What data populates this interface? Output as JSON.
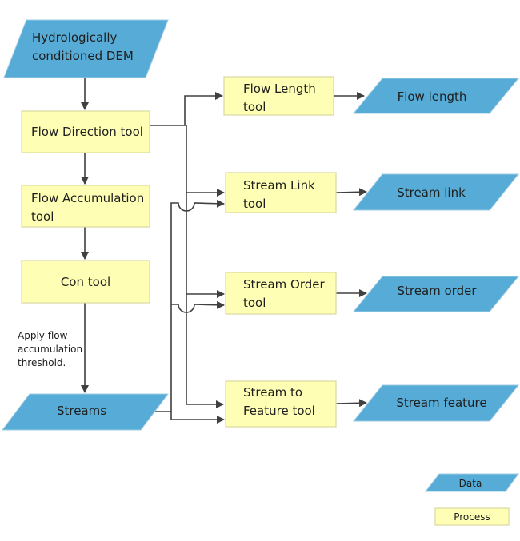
{
  "colors": {
    "data": "#56acd6",
    "process": "#fefeb4",
    "connector": "#404040"
  },
  "nodes": {
    "dem": {
      "lines": [
        "Hydrologically",
        "conditioned DEM"
      ],
      "kind": "data"
    },
    "flow_direction": {
      "lines": [
        "Flow Direction tool"
      ],
      "kind": "process"
    },
    "flow_accumulation": {
      "lines": [
        "Flow Accumulation",
        "tool"
      ],
      "kind": "process"
    },
    "con": {
      "lines": [
        "Con tool"
      ],
      "kind": "process"
    },
    "streams": {
      "lines": [
        "Streams"
      ],
      "kind": "data"
    },
    "flow_length_tool": {
      "lines": [
        "Flow Length",
        "tool"
      ],
      "kind": "process"
    },
    "stream_link_tool": {
      "lines": [
        "Stream Link",
        "tool"
      ],
      "kind": "process"
    },
    "stream_order_tool": {
      "lines": [
        "Stream Order",
        "tool"
      ],
      "kind": "process"
    },
    "stream_to_feature_tool": {
      "lines": [
        "Stream to",
        "Feature tool"
      ],
      "kind": "process"
    },
    "flow_length": {
      "lines": [
        "Flow length"
      ],
      "kind": "data"
    },
    "stream_link": {
      "lines": [
        "Stream link"
      ],
      "kind": "data"
    },
    "stream_order": {
      "lines": [
        "Stream order"
      ],
      "kind": "data"
    },
    "stream_feature": {
      "lines": [
        "Stream feature"
      ],
      "kind": "data"
    }
  },
  "annotation": {
    "lines": [
      "Apply flow",
      "accumulation",
      "threshold."
    ]
  },
  "legend": {
    "data": "Data",
    "process": "Process"
  },
  "edges": [
    [
      "dem",
      "flow_direction"
    ],
    [
      "flow_direction",
      "flow_accumulation"
    ],
    [
      "flow_accumulation",
      "con"
    ],
    [
      "con",
      "streams"
    ],
    [
      "flow_direction",
      "flow_length_tool"
    ],
    [
      "flow_direction",
      "stream_link_tool"
    ],
    [
      "flow_direction",
      "stream_order_tool"
    ],
    [
      "flow_direction",
      "stream_to_feature_tool"
    ],
    [
      "streams",
      "stream_link_tool"
    ],
    [
      "streams",
      "stream_order_tool"
    ],
    [
      "streams",
      "stream_to_feature_tool"
    ],
    [
      "flow_length_tool",
      "flow_length"
    ],
    [
      "stream_link_tool",
      "stream_link"
    ],
    [
      "stream_order_tool",
      "stream_order"
    ],
    [
      "stream_to_feature_tool",
      "stream_feature"
    ]
  ]
}
